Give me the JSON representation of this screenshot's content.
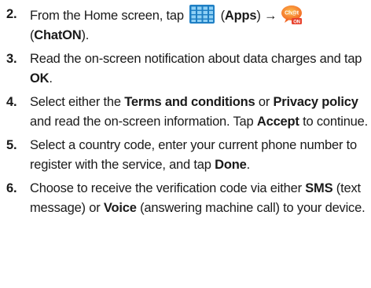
{
  "steps": [
    {
      "number": "2.",
      "text_1": "From the Home screen, tap ",
      "bold_1": "Apps",
      "text_2": " (",
      "text_3": ") ",
      "arrow": "→",
      "text_4": "(",
      "bold_2": "ChatON",
      "text_5": ").",
      "apps_icon": "apps-grid-icon",
      "chaton_icon": "chaton-icon",
      "chaton_icon_text_top": "Ch@t",
      "chaton_icon_text_bottom": "ON"
    },
    {
      "number": "3.",
      "text_1": "Read the on-screen notification about data charges and tap ",
      "bold_1": "OK",
      "text_2": "."
    },
    {
      "number": "4.",
      "text_1": "Select either the ",
      "bold_1": "Terms and conditions",
      "text_2": " or ",
      "bold_2": "Privacy policy",
      "text_3": " and read the on-screen information. Tap ",
      "bold_3": "Accept",
      "text_4": " to continue."
    },
    {
      "number": "5.",
      "text_1": "Select a country code, enter your current phone number to register with the service, and tap ",
      "bold_1": "Done",
      "text_2": "."
    },
    {
      "number": "6.",
      "text_1": "Choose to receive the verification code via either ",
      "bold_1": "SMS",
      "text_2": " (text message) or ",
      "bold_2": "Voice",
      "text_3": " (answering machine call) to your device."
    }
  ],
  "colors": {
    "text": "#1a1a1a",
    "apps_icon_bg": "#1f7fc4",
    "apps_icon_cell": "#8fd0f5",
    "chaton_orange": "#f7941d",
    "chaton_red": "#e8412c"
  }
}
